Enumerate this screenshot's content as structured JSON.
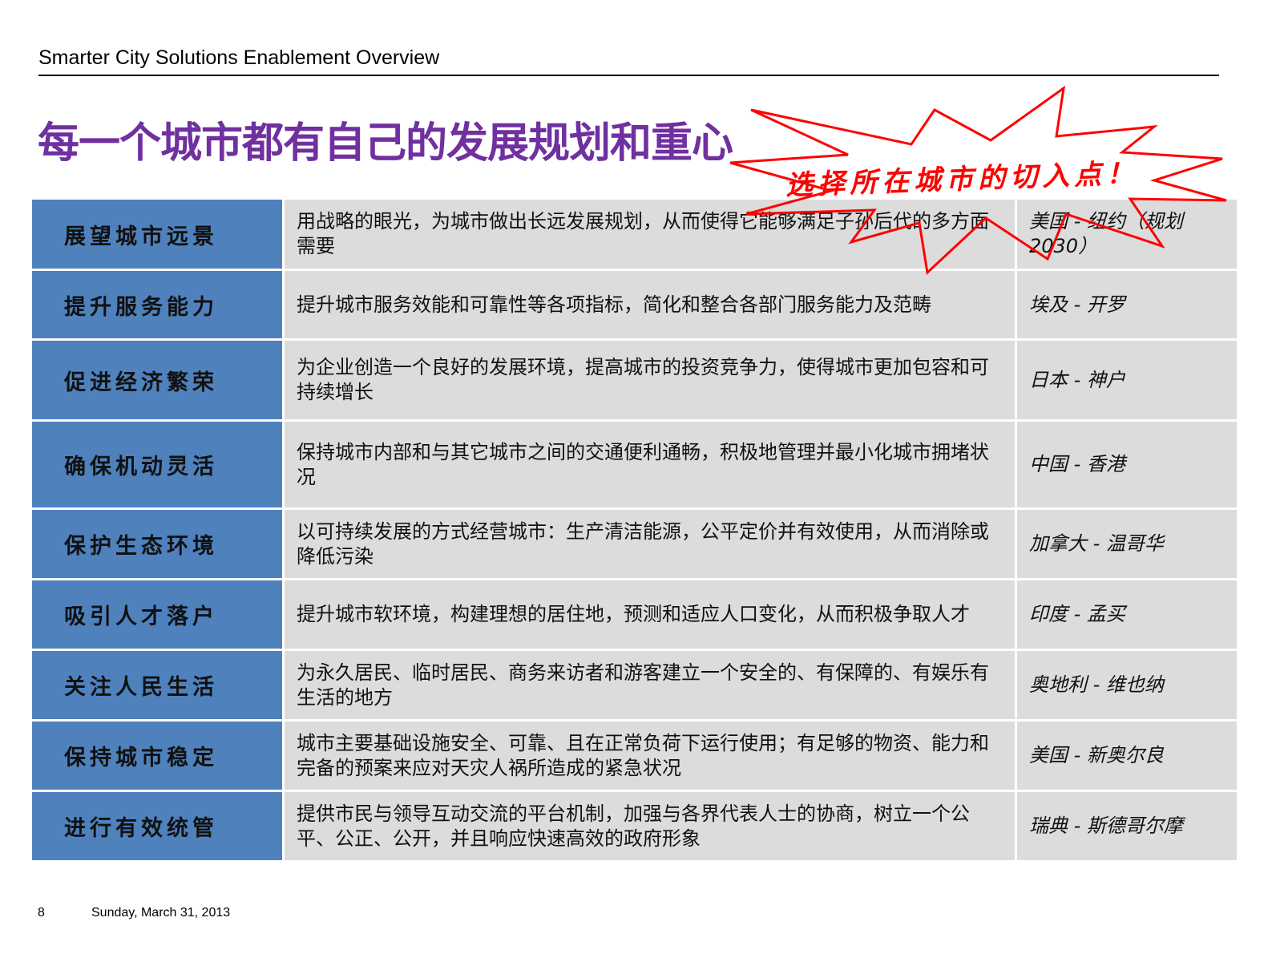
{
  "header": {
    "title": "Smarter City Solutions Enablement Overview"
  },
  "slide_title": "每一个城市都有自己的发展规划和重心",
  "callout": {
    "text": "选择所在城市的切入点！",
    "color": "#ff0000"
  },
  "colors": {
    "key_bg": "#4f81bd",
    "cell_bg": "#dcdcdc",
    "title": "#7030a0"
  },
  "rows": [
    {
      "key": "展望城市远景",
      "desc": "用战略的眼光，为城市做出长远发展规划，从而使得它能够满足子孙后代的多方面需要",
      "city": "美国 - 纽约（规划2030）"
    },
    {
      "key": "提升服务能力",
      "desc": "提升城市服务效能和可靠性等各项指标，简化和整合各部门服务能力及范畴",
      "city": "埃及 - 开罗"
    },
    {
      "key": "促进经济繁荣",
      "desc": "为企业创造一个良好的发展环境，提高城市的投资竞争力，使得城市更加包容和可持续增长",
      "city": "日本 - 神户"
    },
    {
      "key": "确保机动灵活",
      "desc": "保持城市内部和与其它城市之间的交通便利通畅，积极地管理并最小化城市拥堵状况",
      "city": "中国 - 香港"
    },
    {
      "key": "保护生态环境",
      "desc": "以可持续发展的方式经营城市：生产清洁能源，公平定价并有效使用，从而消除或降低污染",
      "city": "加拿大 - 温哥华"
    },
    {
      "key": "吸引人才落户",
      "desc": "提升城市软环境，构建理想的居住地，预测和适应人口变化，从而积极争取人才",
      "city": "印度 - 孟买"
    },
    {
      "key": "关注人民生活",
      "desc": "为永久居民、临时居民、商务来访者和游客建立一个安全的、有保障的、有娱乐有生活的地方",
      "city": "奥地利 - 维也纳"
    },
    {
      "key": "保持城市稳定",
      "desc": "城市主要基础设施安全、可靠、且在正常负荷下运行使用；有足够的物资、能力和完备的预案来应对天灾人祸所造成的紧急状况",
      "city": "美国 - 新奥尔良"
    },
    {
      "key": "进行有效统管",
      "desc": "提供市民与领导互动交流的平台机制，加强与各界代表人士的协商，树立一个公平、公正、公开，并且响应快速高效的政府形象",
      "city": "瑞典 - 斯德哥尔摩"
    }
  ],
  "footer": {
    "page": "8",
    "date": "Sunday, March 31, 2013"
  }
}
